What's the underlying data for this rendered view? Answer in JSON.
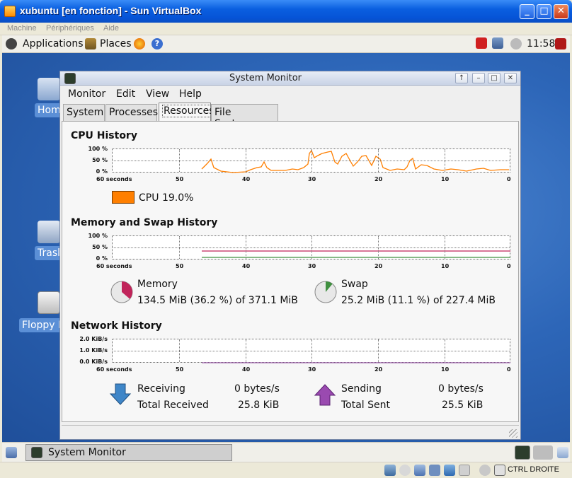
{
  "vbox": {
    "title": "xubuntu [en fonction] - Sun VirtualBox",
    "menu": [
      "Machine",
      "Périphériques",
      "Aide"
    ],
    "host_key": "CTRL DROITE"
  },
  "top_panel": {
    "applications": "Applications",
    "places": "Places",
    "clock": "11:58"
  },
  "desktop_icons": [
    "Hom",
    "Trasl",
    "Floppy D"
  ],
  "monitor": {
    "title": "System Monitor",
    "menu": [
      "Monitor",
      "Edit",
      "View",
      "Help"
    ],
    "tabs": [
      "System",
      "Processes",
      "Resources",
      "File Systems"
    ],
    "active_tab": "Resources",
    "cpu": {
      "title": "CPU History",
      "ylabels": [
        "100 %",
        "50 %",
        "0 %"
      ],
      "legend_label": "CPU",
      "legend_value": "19.0%",
      "color": "#ff7f00"
    },
    "memory": {
      "title": "Memory and Swap History",
      "ylabels": [
        "100 %",
        "50 %",
        "0 %"
      ],
      "mem_label": "Memory",
      "mem_value": "134.5 MiB (36.2 %) of 371.1 MiB",
      "mem_color": "#c0245a",
      "swap_label": "Swap",
      "swap_value": "25.2 MiB (11.1 %) of 227.4 MiB",
      "swap_color": "#3f8f3f"
    },
    "network": {
      "title": "Network History",
      "ylabels": [
        "2.0 KiB/s",
        "1.0 KiB/s",
        "0.0 KiB/s"
      ],
      "receiving_label": "Receiving",
      "receiving_value": "0 bytes/s",
      "total_received_label": "Total Received",
      "total_received_value": "25.8 KiB",
      "sending_label": "Sending",
      "sending_value": "0 bytes/s",
      "total_sent_label": "Total Sent",
      "total_sent_value": "25.5 KiB"
    },
    "xlabels": [
      "60 seconds",
      "50",
      "40",
      "30",
      "20",
      "10",
      "0"
    ]
  },
  "taskbar": {
    "window_label": "System Monitor"
  }
}
